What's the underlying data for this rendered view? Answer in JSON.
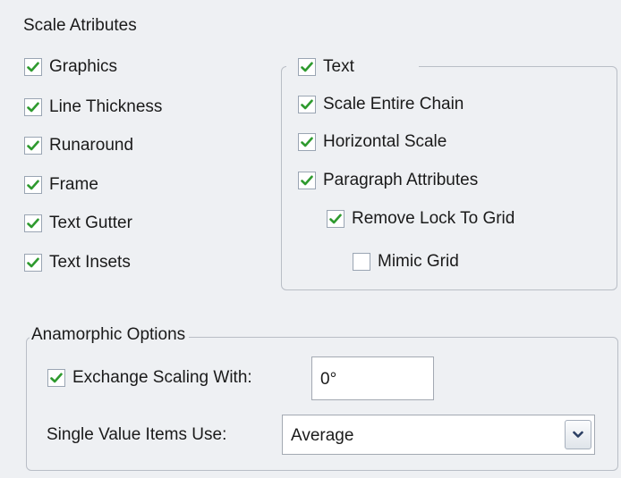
{
  "scale_attributes": {
    "title": "Scale Atributes",
    "left_options": [
      {
        "label": "Graphics",
        "checked": true
      },
      {
        "label": "Line Thickness",
        "checked": true
      },
      {
        "label": "Runaround",
        "checked": true
      },
      {
        "label": "Frame",
        "checked": true
      },
      {
        "label": "Text Gutter",
        "checked": true
      },
      {
        "label": "Text Insets",
        "checked": true
      }
    ],
    "text_group": {
      "label": "Text",
      "checked": true,
      "options": [
        {
          "label": "Scale Entire Chain",
          "checked": true
        },
        {
          "label": "Horizontal Scale",
          "checked": true
        },
        {
          "label": "Paragraph Attributes",
          "checked": true
        },
        {
          "label": "Remove Lock To Grid",
          "checked": true
        },
        {
          "label": "Mimic Grid",
          "checked": false
        }
      ]
    }
  },
  "anamorphic_options": {
    "title": "Anamorphic Options",
    "exchange_scaling": {
      "label": "Exchange Scaling With:",
      "checked": true,
      "value": "0°"
    },
    "single_value_items": {
      "label": "Single Value Items Use:",
      "selected": "Average"
    }
  },
  "colors": {
    "checkmark": "#2e9a2e",
    "checkbox_border": "#9aa5b3",
    "panel_background": "#eef0f3"
  },
  "icons": {
    "checkmark": "checkmark-icon",
    "dropdown": "chevron-down-icon"
  }
}
